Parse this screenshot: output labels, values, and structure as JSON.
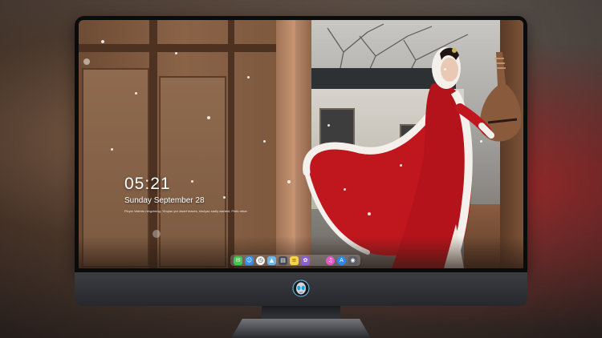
{
  "lockscreen": {
    "time": "05:21",
    "date": "Sunday September 28",
    "quote": "Pinyin Valentu ningcheng, Yinqian yici dwarf leaves, shuiyao sadly wanted, Pinfu rebai"
  },
  "dock": {
    "items": [
      {
        "name": "messages-icon",
        "color": "#3fc84a",
        "glyph": "✉"
      },
      {
        "name": "finder-icon",
        "color": "#3a8de0",
        "glyph": "☺"
      },
      {
        "name": "clock-icon",
        "color": "#f2f2f2",
        "glyph": "◷"
      },
      {
        "name": "maps-icon",
        "color": "#6fb6e8",
        "glyph": "▲"
      },
      {
        "name": "clapper-icon",
        "color": "#444a55",
        "glyph": "▤"
      },
      {
        "name": "notes-icon",
        "color": "#f5d44a",
        "glyph": "≡"
      },
      {
        "name": "photos-icon",
        "color": "#8a5fd8",
        "glyph": "✿"
      },
      {
        "name": "itunes-icon",
        "color": "#e657c8",
        "glyph": "♫"
      },
      {
        "name": "appstore-icon",
        "color": "#2c89ec",
        "glyph": "A"
      },
      {
        "name": "camera-icon",
        "color": "#5a5d63",
        "glyph": "◉"
      }
    ]
  },
  "colors": {
    "screen_bezel": "#0b0b0c",
    "chin": "#2f3135",
    "robe": "#c0171f",
    "fur": "#f4f1ec"
  }
}
